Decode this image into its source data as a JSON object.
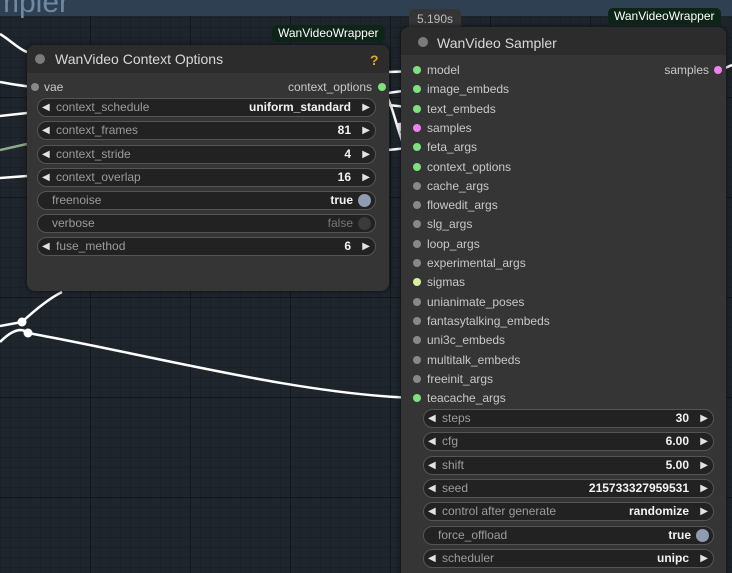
{
  "background": {
    "group_title": "mpler",
    "colors": {
      "canvas": "#1e252c",
      "group": "#2f4052",
      "wire": "#ffffff",
      "wire_secondary": "#8aa88a"
    }
  },
  "context_node": {
    "title": "WanVideo Context Options",
    "badge": "WanVideoWrapper",
    "help_icon": "?",
    "inputs": [
      {
        "label": "vae",
        "color": "#888888"
      }
    ],
    "outputs": [
      {
        "label": "context_options",
        "color": "#7ee07e"
      }
    ],
    "widgets": [
      {
        "label": "context_schedule",
        "value": "uniform_standard",
        "kind": "combo"
      },
      {
        "label": "context_frames",
        "value": "81",
        "kind": "number"
      },
      {
        "label": "context_stride",
        "value": "4",
        "kind": "number"
      },
      {
        "label": "context_overlap",
        "value": "16",
        "kind": "number"
      },
      {
        "label": "freenoise",
        "value": "true",
        "kind": "toggle",
        "on": true
      },
      {
        "label": "verbose",
        "value": "false",
        "kind": "toggle",
        "on": false
      },
      {
        "label": "fuse_method",
        "value": "6",
        "kind": "combo"
      }
    ]
  },
  "sampler_node": {
    "exec_time": "5.190s",
    "title": "WanVideo Sampler",
    "badge": "WanVideoWrapper",
    "inputs": [
      {
        "label": "model",
        "color": "#7ee07e"
      },
      {
        "label": "image_embeds",
        "color": "#7ee07e"
      },
      {
        "label": "text_embeds",
        "color": "#7ee07e"
      },
      {
        "label": "samples",
        "color": "#f080f0"
      },
      {
        "label": "feta_args",
        "color": "#7ee07e"
      },
      {
        "label": "context_options",
        "color": "#7ee07e"
      },
      {
        "label": "cache_args",
        "color": "#888888"
      },
      {
        "label": "flowedit_args",
        "color": "#888888"
      },
      {
        "label": "slg_args",
        "color": "#888888"
      },
      {
        "label": "loop_args",
        "color": "#888888"
      },
      {
        "label": "experimental_args",
        "color": "#888888"
      },
      {
        "label": "sigmas",
        "color": "#d8f0a0"
      },
      {
        "label": "unianimate_poses",
        "color": "#888888"
      },
      {
        "label": "fantasytalking_embeds",
        "color": "#888888"
      },
      {
        "label": "uni3c_embeds",
        "color": "#888888"
      },
      {
        "label": "multitalk_embeds",
        "color": "#888888"
      },
      {
        "label": "freeinit_args",
        "color": "#888888"
      },
      {
        "label": "teacache_args",
        "color": "#7ee07e"
      }
    ],
    "outputs": [
      {
        "label": "samples",
        "color": "#f080f0"
      }
    ],
    "widgets": [
      {
        "label": "steps",
        "value": "30",
        "kind": "number"
      },
      {
        "label": "cfg",
        "value": "6.00",
        "kind": "number"
      },
      {
        "label": "shift",
        "value": "5.00",
        "kind": "number"
      },
      {
        "label": "seed",
        "value": "215733327959531",
        "kind": "number"
      },
      {
        "label": "control after generate",
        "value": "randomize",
        "kind": "combo"
      },
      {
        "label": "force_offload",
        "value": "true",
        "kind": "toggle",
        "on": true
      },
      {
        "label": "scheduler",
        "value": "unipc",
        "kind": "combo"
      }
    ]
  },
  "icons": {
    "decrement": "◀",
    "increment": "▶",
    "collapse": "collapse-dot-icon"
  }
}
